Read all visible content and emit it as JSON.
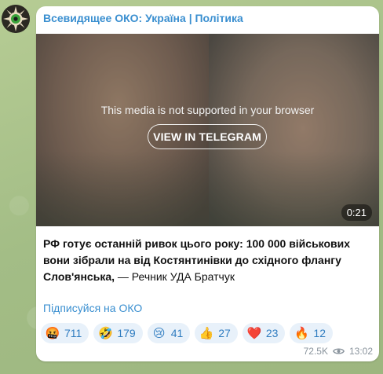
{
  "channel": {
    "name": "Всевидящее ОКО: Україна | Політика",
    "avatar_icon": "eye-emblem-icon"
  },
  "media": {
    "unsupported_text": "This media is not supported in your browser",
    "view_button_label": "VIEW IN TELEGRAM",
    "duration": "0:21"
  },
  "post": {
    "bold_text": "РФ готує останній ривок цього року: 100 000 військових вони зібрали на від Костянтинівки до східного флангу Слов'янська,",
    "regular_text": " — Речник УДА Братчук",
    "subscribe_link": "Підписуйся на ОКО"
  },
  "reactions": [
    {
      "emoji": "🤬",
      "icon": "angry-face-icon",
      "count": "711"
    },
    {
      "emoji": "🤣",
      "icon": "laughing-face-icon",
      "count": "179"
    },
    {
      "emoji": "😢",
      "icon": "crying-face-icon",
      "count": "41"
    },
    {
      "emoji": "👍",
      "icon": "thumbs-up-icon",
      "count": "27"
    },
    {
      "emoji": "❤️",
      "icon": "heart-icon",
      "count": "23"
    },
    {
      "emoji": "🔥",
      "icon": "fire-icon",
      "count": "12"
    }
  ],
  "meta": {
    "views": "72.5K",
    "time": "13:02"
  },
  "colors": {
    "accent": "#3a8fd0",
    "reaction_bg": "#e8f1fa",
    "wallpaper": "#a9c18c"
  }
}
